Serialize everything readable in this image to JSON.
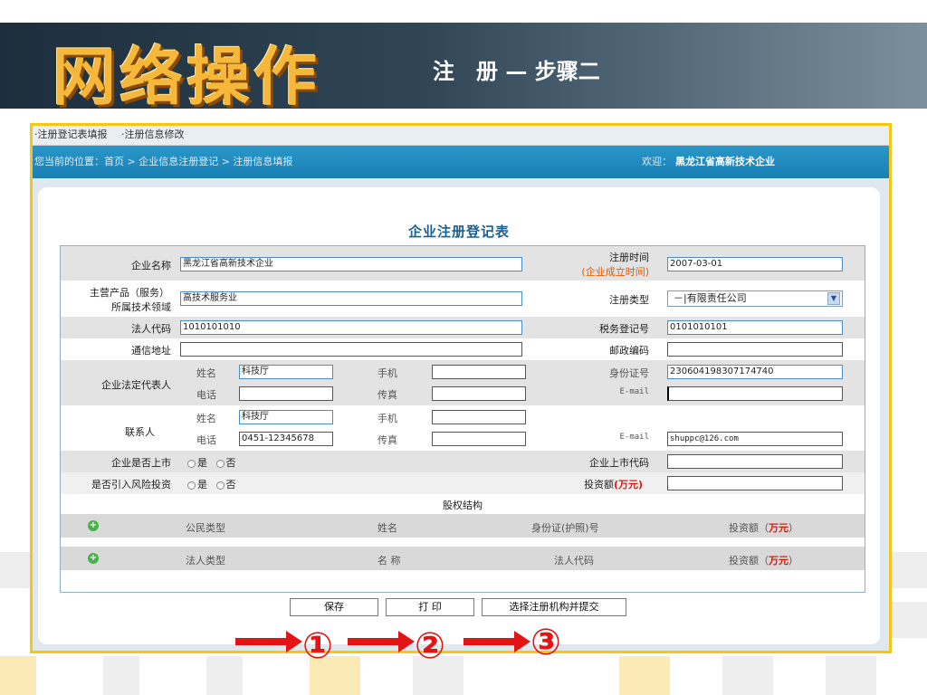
{
  "slide": {
    "title": "网络操作",
    "subtitle": "注　册 — 步骤二"
  },
  "topnav": {
    "items": [
      "·注册登记表填报",
      "·注册信息修改"
    ]
  },
  "location": {
    "breadcrumb": "您当前的位置：首页 > 企业信息注册登记 > 注册信息填报",
    "welcome_label": "欢迎：",
    "company": "黑龙江省高新技术企业"
  },
  "form": {
    "title": "企业注册登记表",
    "labels": {
      "company_name": "企业名称",
      "reg_time": "注册时间",
      "reg_time_sub": "(企业成立时间)",
      "main_product": "主营产品（服务）",
      "tech_field": "所属技术领域",
      "reg_type": "注册类型",
      "legal_code": "法人代码",
      "tax_no": "税务登记号",
      "address": "通信地址",
      "postcode": "邮政编码",
      "legal_rep": "企业法定代表人",
      "contact": "联系人",
      "name": "姓名",
      "mobile": "手机",
      "phone": "电话",
      "fax": "传真",
      "id_no": "身份证号",
      "email": "E-mail",
      "listed": "企业是否上市",
      "listed_code": "企业上市代码",
      "vc": "是否引入风险投资",
      "invest": "投资额",
      "invest_unit": "(万元)",
      "yes": "是",
      "no": "否",
      "equity": "股权结构"
    },
    "values": {
      "company_name": "黑龙江省高新技术企业",
      "reg_time": "2007-03-01",
      "tech_field": "高技术服务业",
      "reg_type": "－|有限责任公司",
      "legal_code": "1010101010",
      "tax_no": "0101010101",
      "address": "",
      "postcode": "",
      "rep_name": "科技厅",
      "rep_mobile": "",
      "rep_id": "230604198307174740",
      "rep_phone": "",
      "rep_fax": "",
      "rep_email": "",
      "contact_name": "科技厅",
      "contact_mobile": "",
      "contact_phone": "0451-12345678",
      "contact_fax": "",
      "contact_email": "shuppc@126.com",
      "listed_code": "",
      "invest": ""
    },
    "equity_table1": {
      "headers": [
        "公民类型",
        "姓名",
        "身份证(护照)号",
        "投资额（",
        "万元",
        "）"
      ]
    },
    "equity_table2": {
      "headers": [
        "法人类型",
        "名 称",
        "法人代码",
        "投资额（",
        "万元",
        "）"
      ]
    },
    "buttons": {
      "save": "保存",
      "print": "打 印",
      "submit": "选择注册机构并提交"
    }
  },
  "steps": [
    "①",
    "②",
    "③"
  ],
  "colors": {
    "frame": "#f5c518",
    "header_bar": "#1a7fb4",
    "arrow": "#e31414",
    "title_orange": "#f6b83a"
  }
}
